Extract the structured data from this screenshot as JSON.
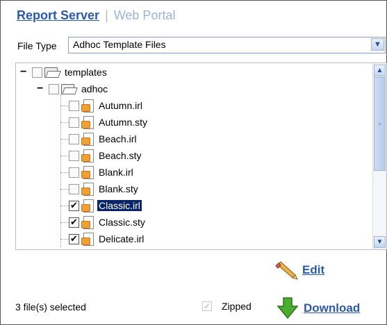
{
  "tabs": {
    "active": "Report Server",
    "separator": "|",
    "inactive": "Web Portal"
  },
  "file_type": {
    "label": "File Type",
    "selected": "Adhoc Template Files"
  },
  "tree": {
    "root": {
      "label": "templates",
      "expanded": true
    },
    "folder": {
      "label": "adhoc",
      "expanded": true
    },
    "files": [
      {
        "label": "Autumn.irl",
        "checked": false,
        "selected": false
      },
      {
        "label": "Autumn.sty",
        "checked": false,
        "selected": false
      },
      {
        "label": "Beach.irl",
        "checked": false,
        "selected": false
      },
      {
        "label": "Beach.sty",
        "checked": false,
        "selected": false
      },
      {
        "label": "Blank.irl",
        "checked": false,
        "selected": false
      },
      {
        "label": "Blank.sty",
        "checked": false,
        "selected": false
      },
      {
        "label": "Classic.irl",
        "checked": true,
        "selected": true
      },
      {
        "label": "Classic.sty",
        "checked": true,
        "selected": false
      },
      {
        "label": "Delicate.irl",
        "checked": true,
        "selected": false
      }
    ]
  },
  "actions": {
    "edit": "Edit",
    "download": "Download",
    "zipped": "Zipped"
  },
  "status": "3 file(s) selected",
  "colors": {
    "link": "#2a5aa8",
    "selected_bg": "#0a246a"
  }
}
